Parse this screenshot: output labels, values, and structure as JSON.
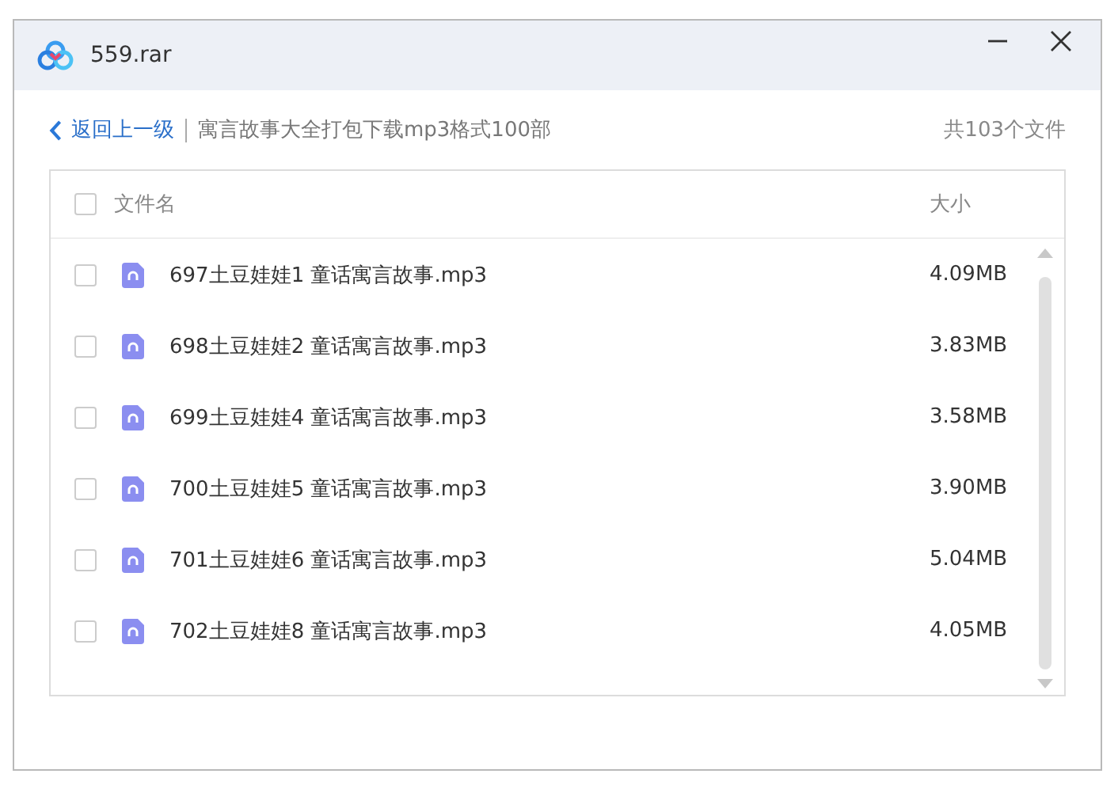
{
  "window": {
    "title": "559.rar"
  },
  "breadcrumb": {
    "back": "返回上一级",
    "path": "寓言故事大全打包下载mp3格式100部",
    "count": "共103个文件"
  },
  "table": {
    "columns": [
      "文件名",
      "大小"
    ],
    "select_all": {
      "checked": false
    },
    "rows": [
      {
        "name": "697土豆娃娃1 童话寓言故事.mp3",
        "size": "4.09MB",
        "checked": false
      },
      {
        "name": "698土豆娃娃2 童话寓言故事.mp3",
        "size": "3.83MB",
        "checked": false
      },
      {
        "name": "699土豆娃娃4 童话寓言故事.mp3",
        "size": "3.58MB",
        "checked": false
      },
      {
        "name": "700土豆娃娃5 童话寓言故事.mp3",
        "size": "3.90MB",
        "checked": false
      },
      {
        "name": "701土豆娃娃6 童话寓言故事.mp3",
        "size": "5.04MB",
        "checked": false
      },
      {
        "name": "702土豆娃娃8 童话寓言故事.mp3",
        "size": "4.05MB",
        "checked": false
      }
    ]
  }
}
